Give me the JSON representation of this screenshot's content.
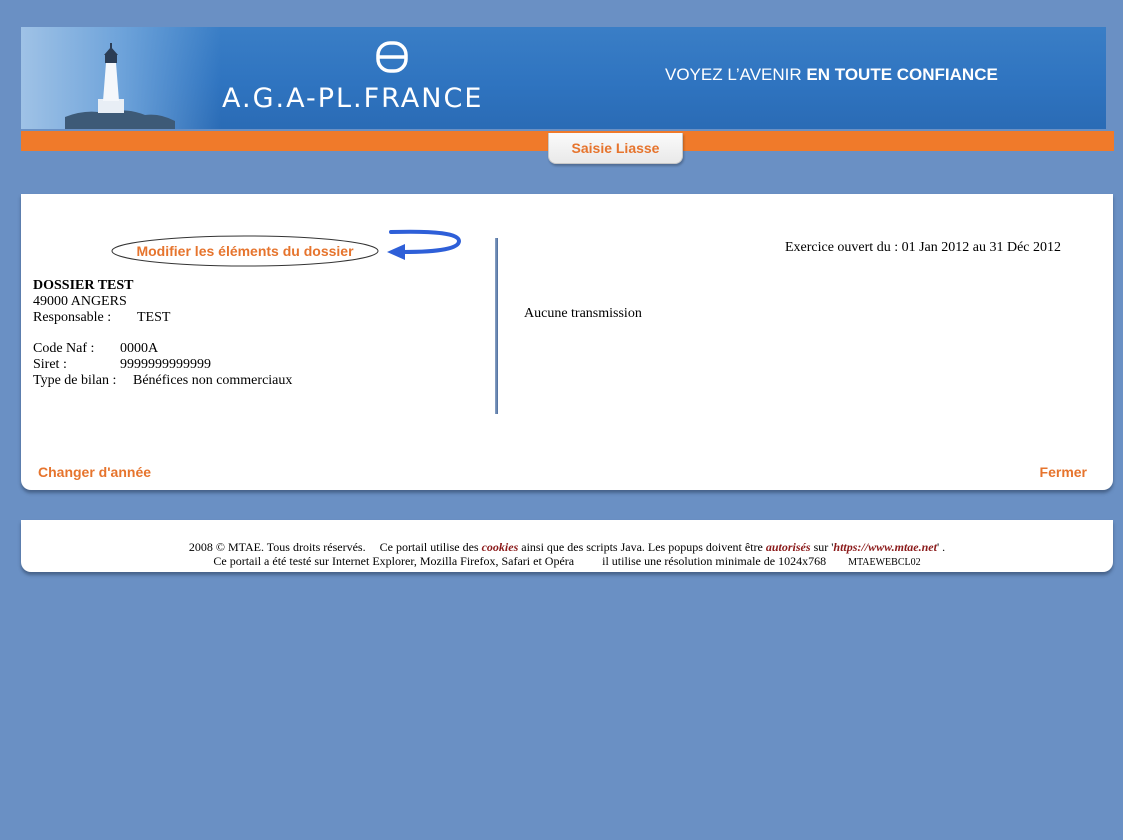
{
  "header": {
    "logo_text": "A.G.A-PL.FRANCE",
    "tagline_regular": "VOYEZ L’AVENIR ",
    "tagline_bold": "EN TOUTE CONFIANCE",
    "active_tab": "Saisie Liasse"
  },
  "dossier": {
    "modify_link": "Modifier les éléments du dossier",
    "name": "DOSSIER TEST",
    "city": "49000 ANGERS",
    "responsable_label": "Responsable :",
    "responsable_value": "TEST",
    "naf_label": "Code Naf :",
    "naf_value": "0000A",
    "siret_label": "Siret :",
    "siret_value": "9999999999999",
    "bilan_label": "Type de bilan :",
    "bilan_value": "Bénéfices non commerciaux"
  },
  "exercise": {
    "label": "Exercice ouvert du : 01 Jan 2012 au 31 Déc 2012"
  },
  "transmission": {
    "status": "Aucune transmission"
  },
  "actions": {
    "change_year": "Changer d'année",
    "close": "Fermer"
  },
  "footer": {
    "line1_a": "2008 © MTAE. Tous droits réservés.",
    "line1_b": "Ce portail utilise des ",
    "line1_cookies": "cookies",
    "line1_c": " ainsi que des scripts Java. Les popups doivent être ",
    "line1_autorises": "autorisés",
    "line1_d": " sur '",
    "line1_url": "https://www.mtae.net",
    "line1_e": "' .",
    "line2_a": "Ce portail a été testé sur Internet Explorer, Mozilla Firefox, Safari et Opéra",
    "line2_b": "il utilise une résolution minimale de 1024x768",
    "line2_code": "MTAEWEBCL02"
  },
  "colors": {
    "background": "#6a90c4",
    "banner_blue": "#2f74c0",
    "orange": "#f07a2a",
    "link_orange": "#e6742d",
    "arrow_blue": "#2e5fd8",
    "footer_highlight": "#8b1a1a"
  },
  "icons": {
    "lighthouse": "lighthouse-icon",
    "logo": "aga-logo-icon",
    "arrow": "curved-arrow-icon"
  }
}
